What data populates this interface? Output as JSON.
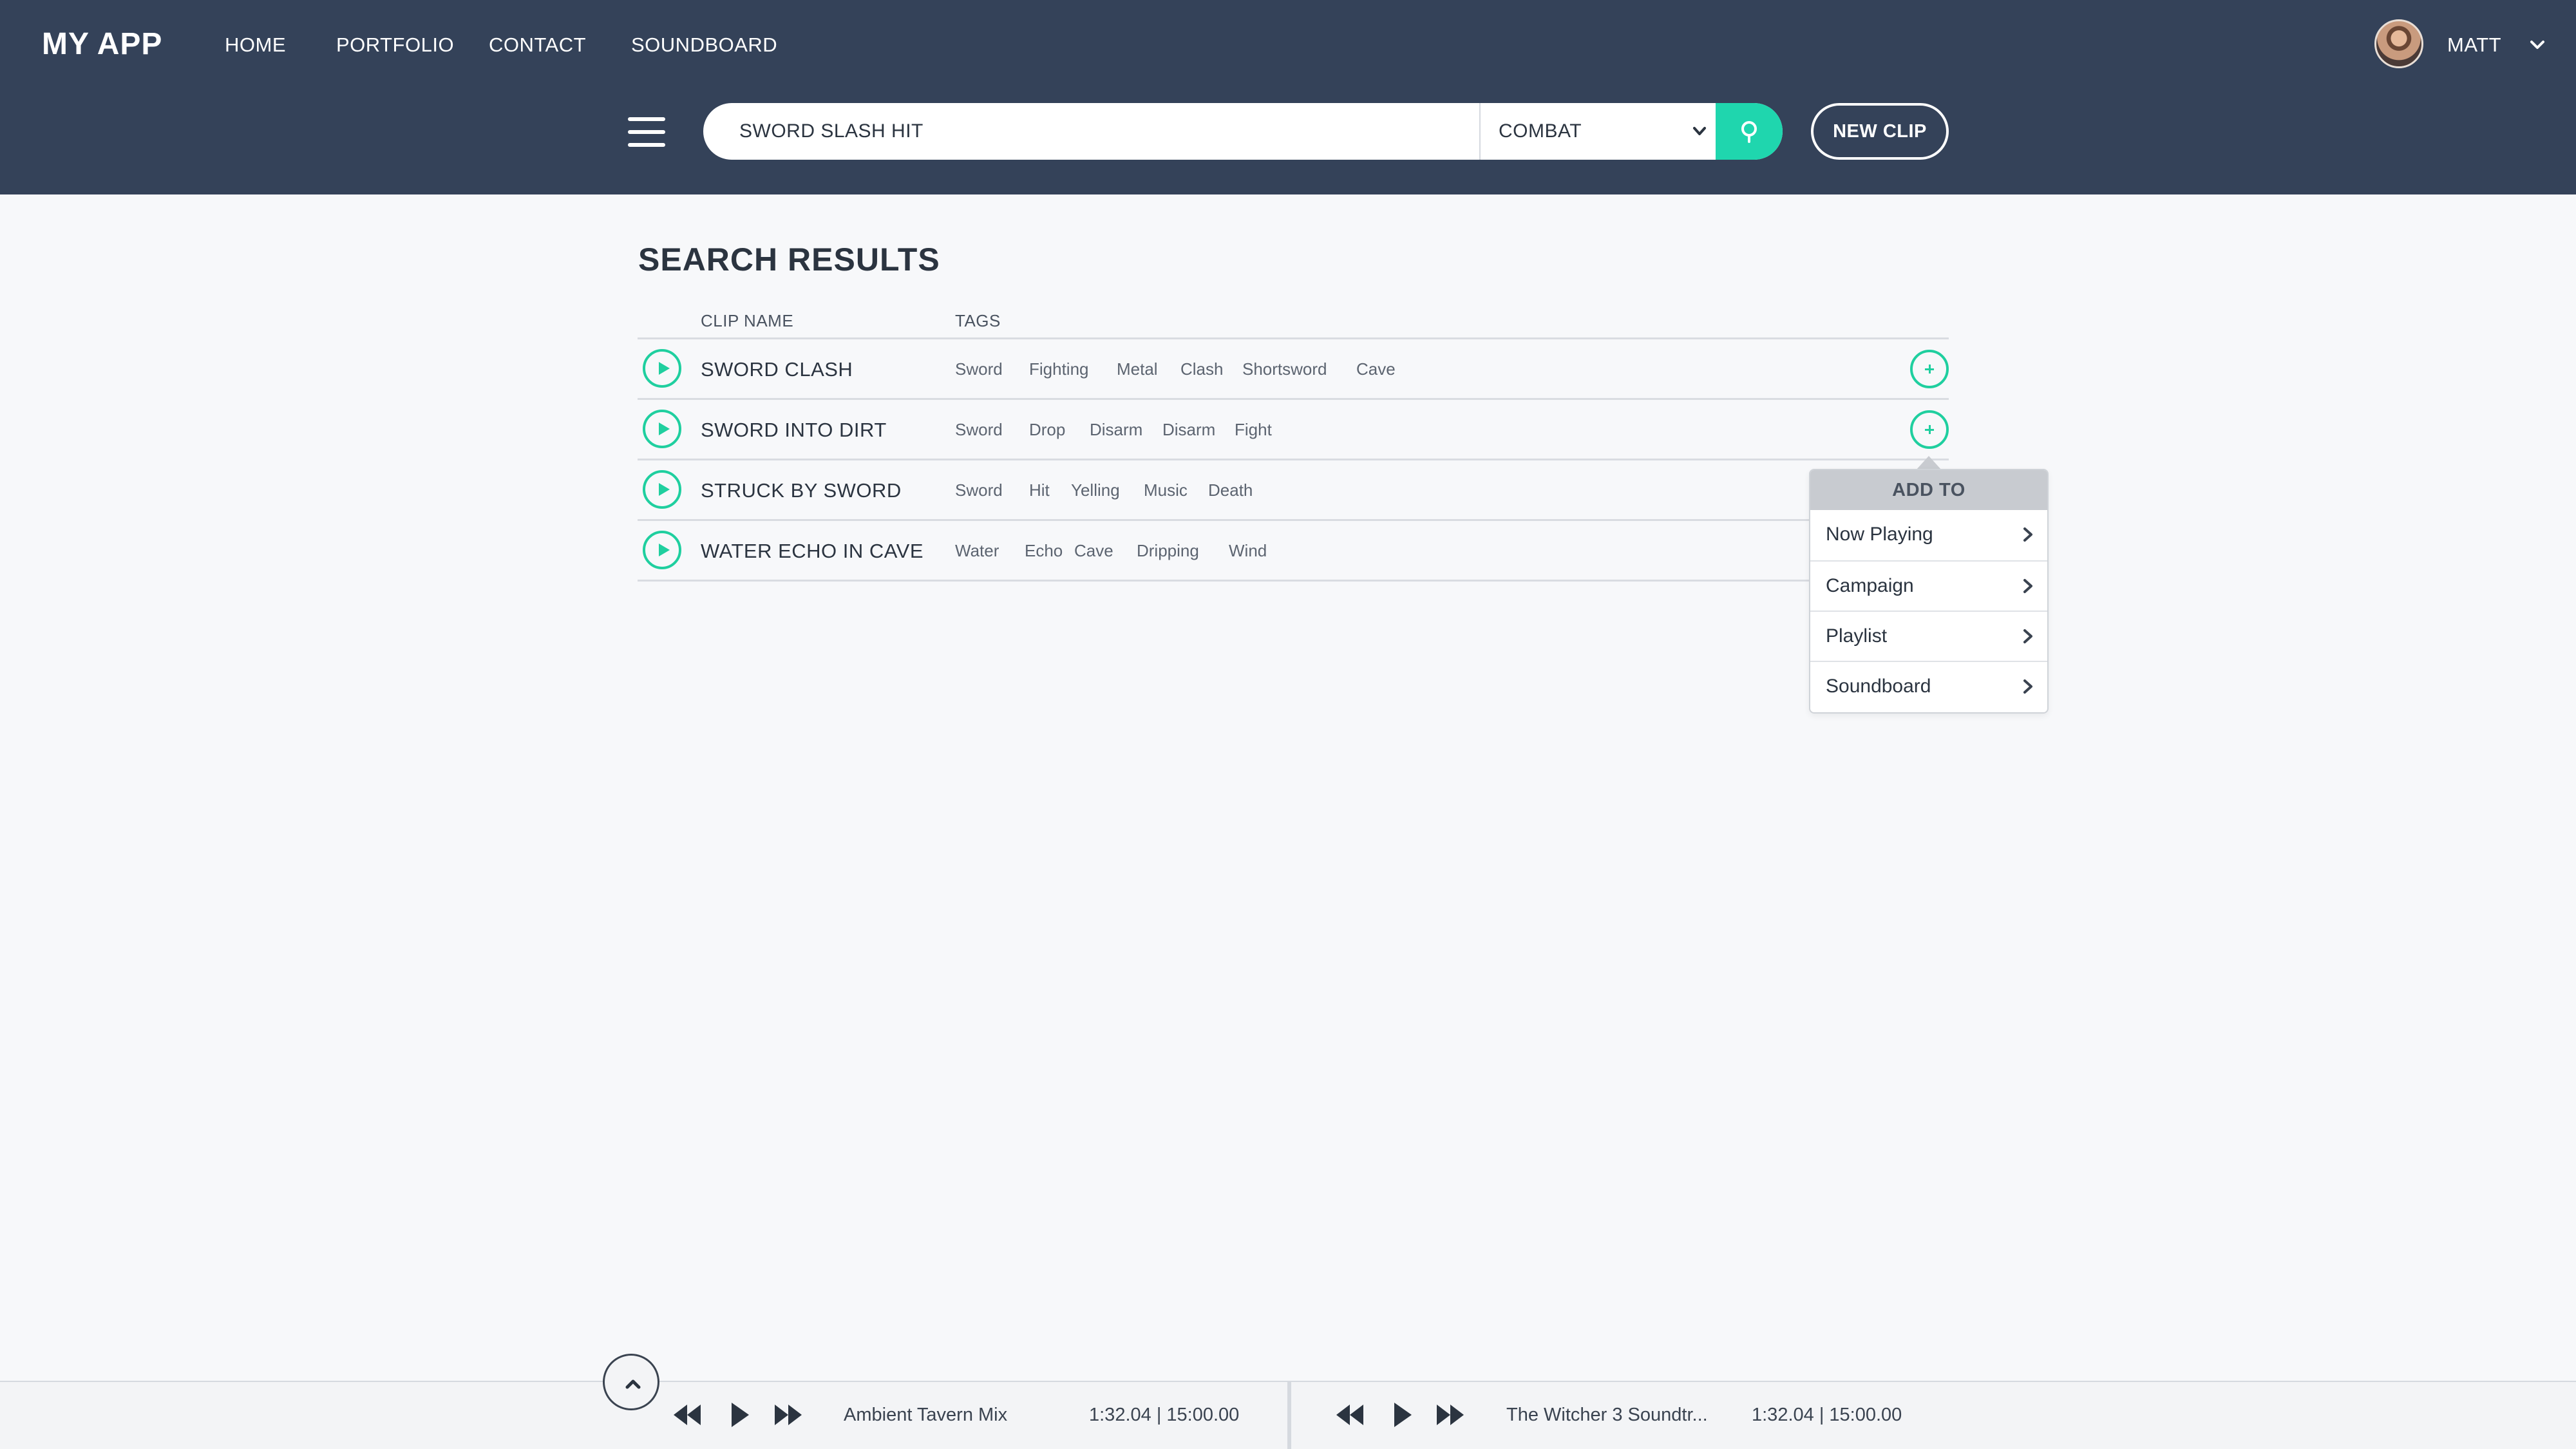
{
  "header": {
    "logo": "MY APP",
    "nav": [
      {
        "label": "HOME"
      },
      {
        "label": "PORTFOLIO"
      },
      {
        "label": "CONTACT"
      },
      {
        "label": "SOUNDBOARD"
      }
    ],
    "user": {
      "name": "MATT"
    }
  },
  "search": {
    "query": "SWORD SLASH HIT",
    "category": "COMBAT",
    "new_clip_label": "NEW CLIP"
  },
  "results": {
    "title": "SEARCH RESULTS",
    "columns": {
      "clip_name": "CLIP NAME",
      "tags": "TAGS"
    },
    "rows": [
      {
        "name": "SWORD CLASH",
        "tags": [
          "Sword",
          "Fighting",
          "Metal",
          "Clash",
          "Shortsword",
          "Cave"
        ]
      },
      {
        "name": "SWORD INTO DIRT",
        "tags": [
          "Sword",
          "Drop",
          "Disarm",
          "Disarm",
          "Fight"
        ]
      },
      {
        "name": "STRUCK BY SWORD",
        "tags": [
          "Sword",
          "Hit",
          "Yelling",
          "Music",
          "Death"
        ]
      },
      {
        "name": "WATER ECHO IN CAVE",
        "tags": [
          "Water",
          "Echo",
          "Cave",
          "Dripping",
          "Wind"
        ]
      }
    ]
  },
  "add_to_menu": {
    "title": "ADD TO",
    "items": [
      {
        "label": "Now Playing"
      },
      {
        "label": "Campaign"
      },
      {
        "label": "Playlist"
      },
      {
        "label": "Soundboard"
      }
    ]
  },
  "players": [
    {
      "track": "Ambient Tavern Mix",
      "time": "1:32.04 | 15:00.00"
    },
    {
      "track": "The Witcher 3 Soundtr...",
      "time": "1:32.04 | 15:00.00"
    }
  ],
  "colors": {
    "header_bg": "#344259",
    "accent": "#1fd6ae",
    "page_bg": "#f7f8fa",
    "text": "#2b3440"
  }
}
